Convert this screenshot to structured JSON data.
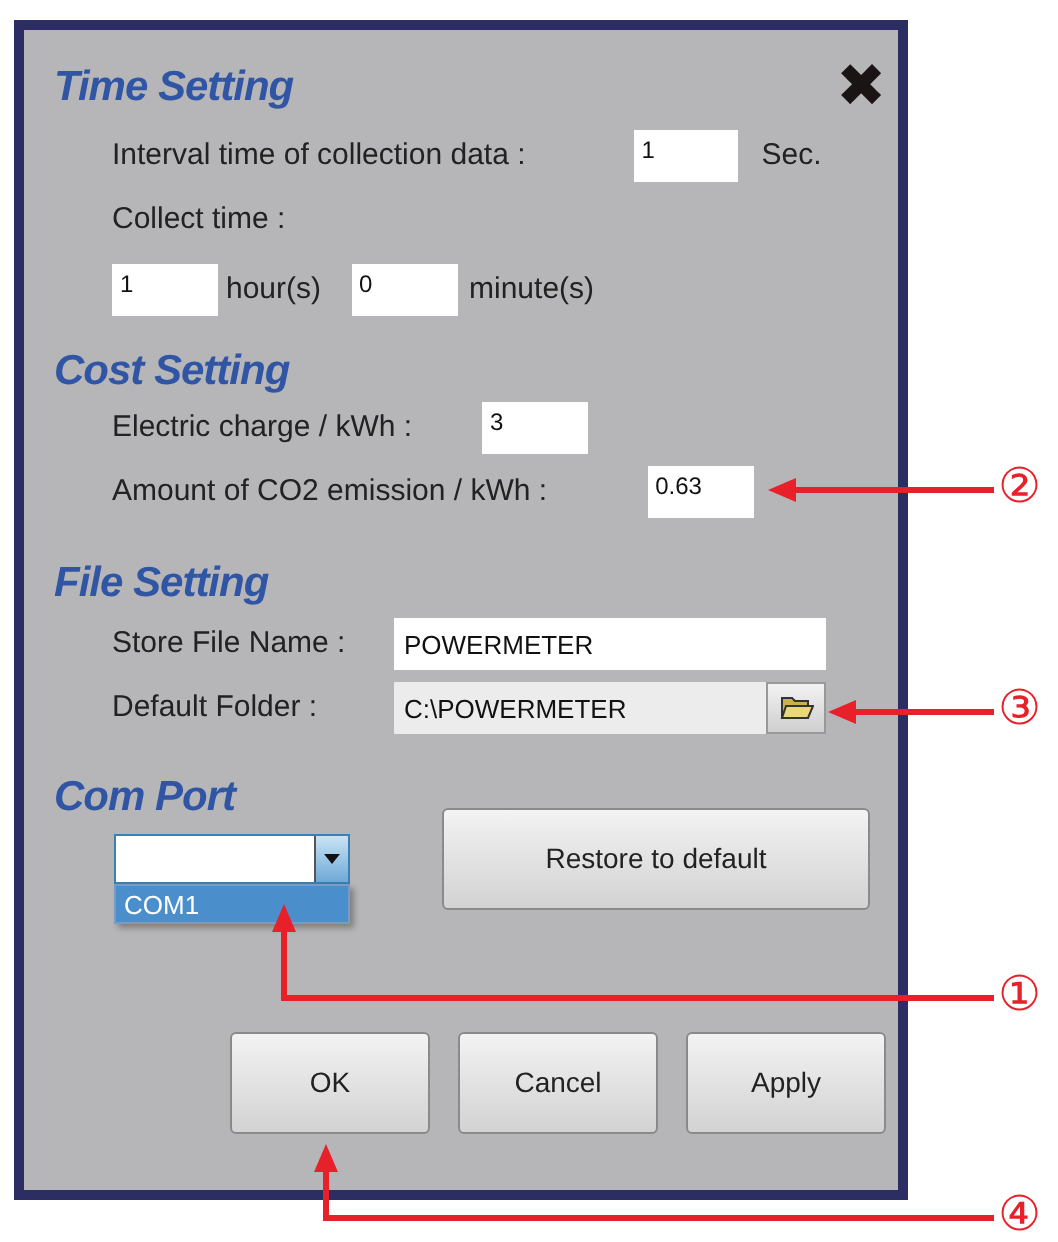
{
  "dialog": {
    "close_glyph": "✖"
  },
  "time_setting": {
    "heading": "Time Setting",
    "interval_label": "Interval time of collection data :",
    "interval_value": "1",
    "interval_unit": "Sec.",
    "collect_label": "Collect time :",
    "hours_value": "1",
    "hours_unit": "hour(s)",
    "minutes_value": "0",
    "minutes_unit": "minute(s)"
  },
  "cost_setting": {
    "heading": "Cost Setting",
    "charge_label": "Electric charge / kWh :",
    "charge_value": "3",
    "co2_label": "Amount of CO2  emission / kWh :",
    "co2_value": "0.63"
  },
  "file_setting": {
    "heading": "File Setting",
    "store_label": "Store File Name :",
    "store_value": "POWERMETER",
    "folder_label": "Default Folder :",
    "folder_value": "C:\\POWERMETER"
  },
  "com_port": {
    "heading": "Com Port",
    "expanded": true,
    "options": [
      {
        "label": "COM1",
        "selected": true
      }
    ],
    "restore_button": "Restore to default"
  },
  "buttons": [
    "OK",
    "Cancel",
    "Apply"
  ],
  "callouts": [
    {
      "number": "②"
    },
    {
      "number": "③"
    },
    {
      "number": "①"
    },
    {
      "number": "④"
    }
  ]
}
